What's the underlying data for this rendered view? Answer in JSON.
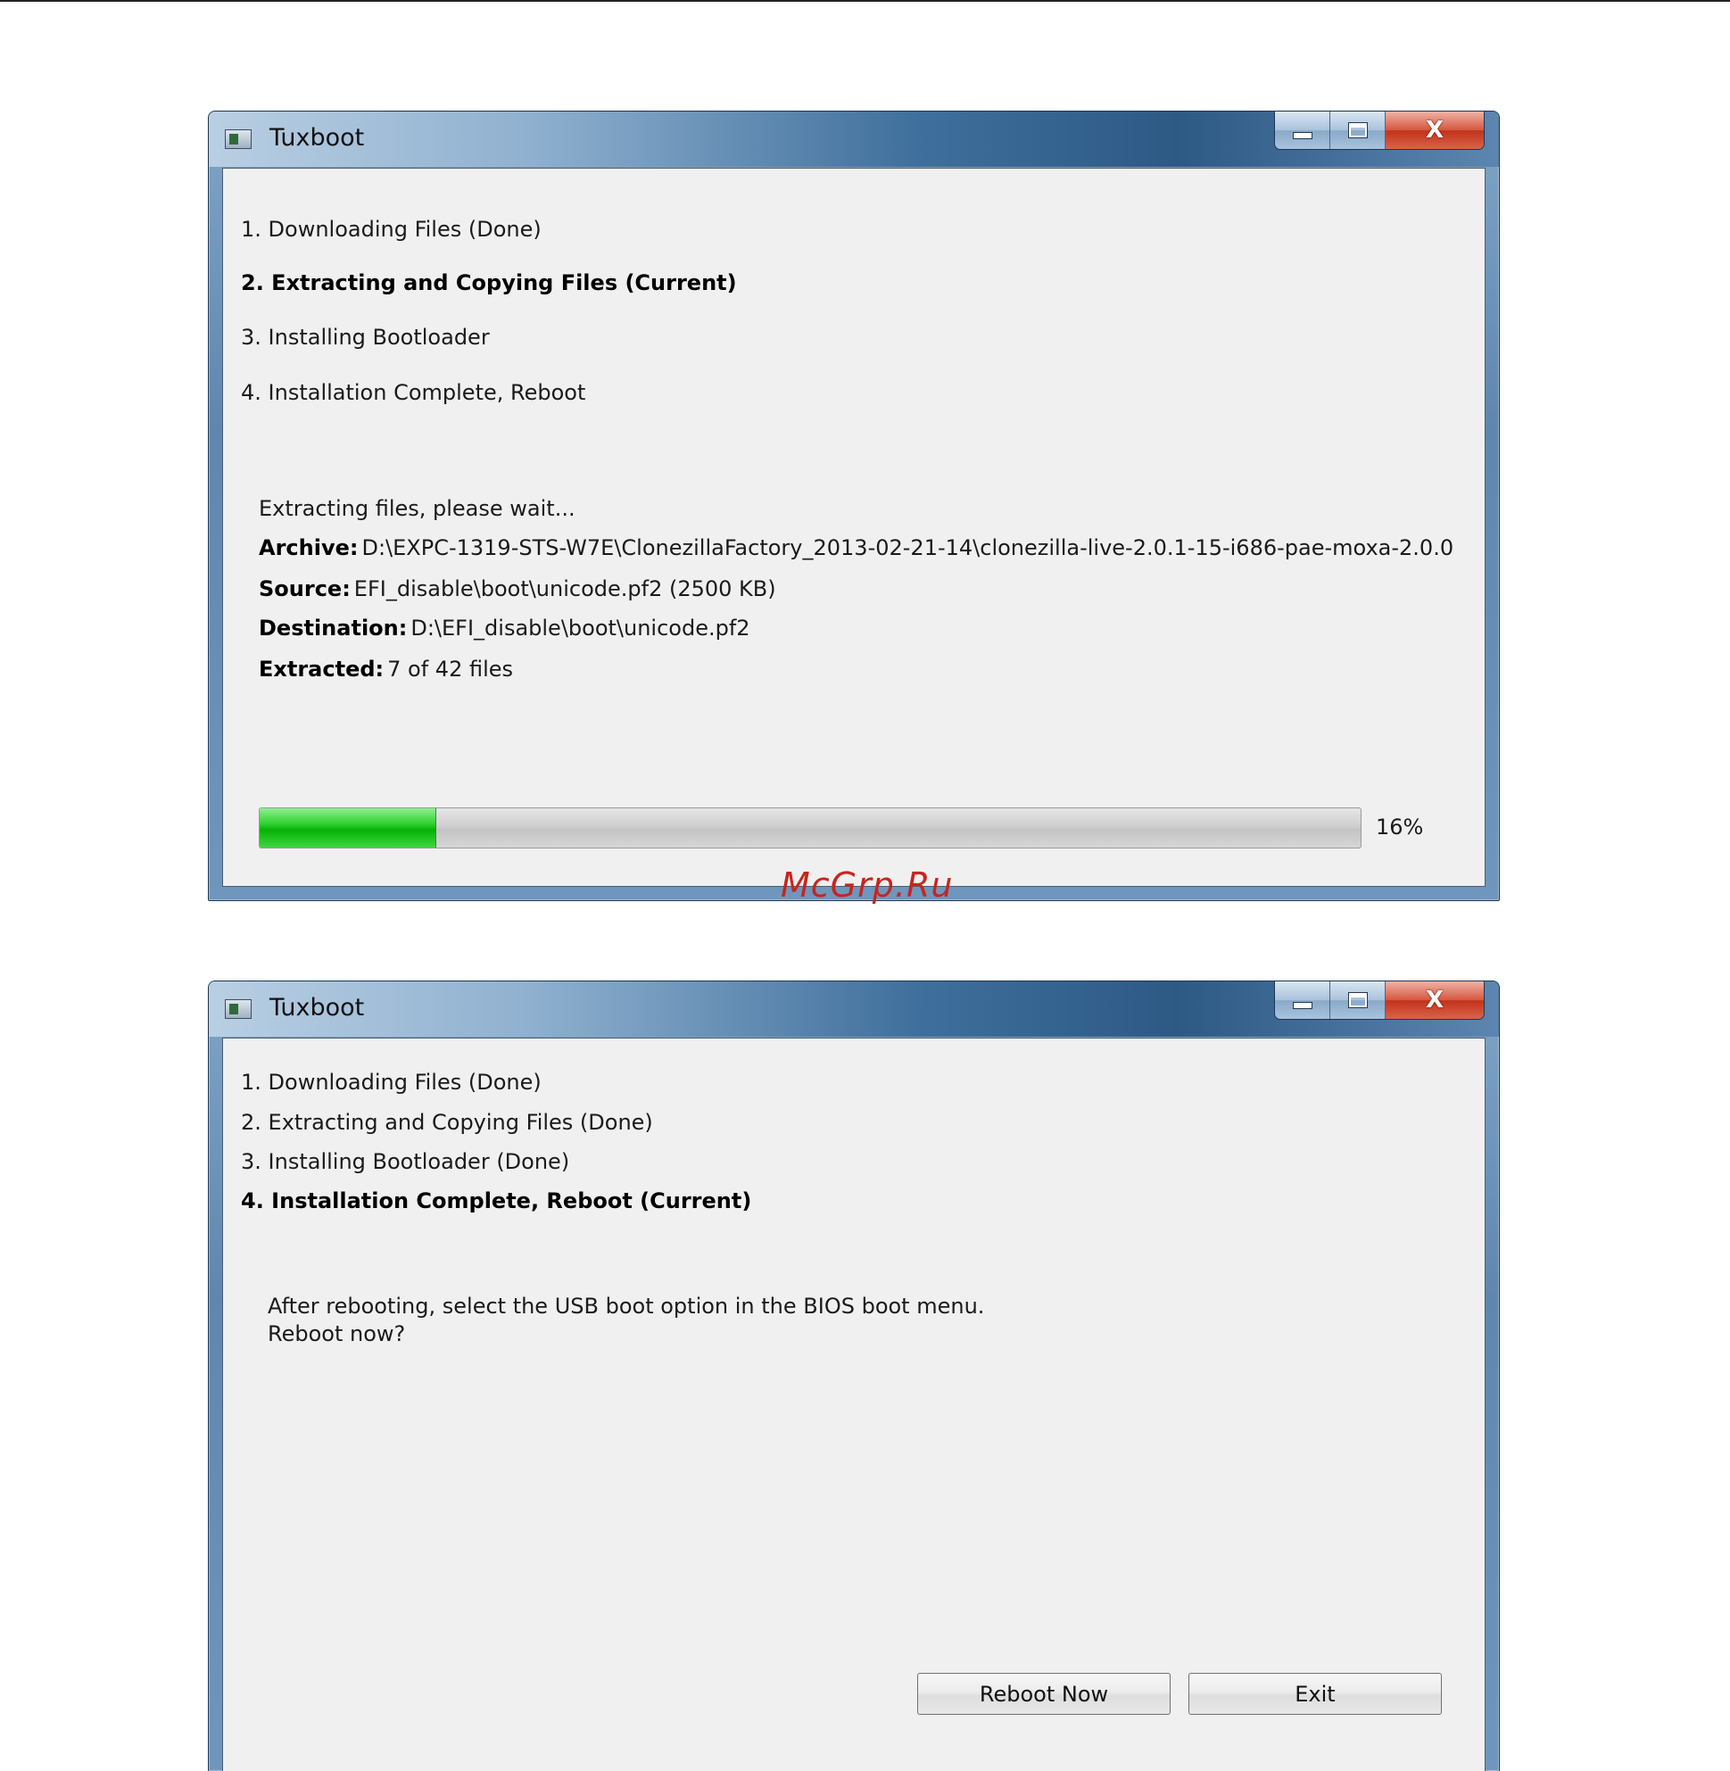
{
  "watermark": "McGrp.Ru",
  "window_top": {
    "title": "Tuxboot",
    "caption": {
      "minimize": "—",
      "maximize": "□",
      "close": "X"
    },
    "steps": [
      {
        "text": "1. Downloading Files (Done)",
        "current": false
      },
      {
        "text": "2. Extracting and Copying Files (Current)",
        "current": true
      },
      {
        "text": "3. Installing Bootloader",
        "current": false
      },
      {
        "text": "4. Installation Complete, Reboot",
        "current": false
      }
    ],
    "status": "Extracting files, please wait...",
    "archive": {
      "label": "Archive:",
      "value": "D:\\EXPC-1319-STS-W7E\\ClonezillaFactory_2013-02-21-14\\clonezilla-live-2.0.1-15-i686-pae-moxa-2.0.0"
    },
    "source": {
      "label": "Source:",
      "value": "EFI_disable\\boot\\unicode.pf2 (2500 KB)"
    },
    "destination": {
      "label": "Destination:",
      "value": "D:\\EFI_disable\\boot\\unicode.pf2"
    },
    "extracted": {
      "label": "Extracted:",
      "value": "7 of 42 files"
    },
    "progress": {
      "percent": 16,
      "text": "16%",
      "fill_color": "#14c414"
    }
  },
  "window_bottom": {
    "title": "Tuxboot",
    "caption": {
      "minimize": "—",
      "maximize": "□",
      "close": "X"
    },
    "steps": [
      {
        "text": "1. Downloading Files (Done)",
        "current": false
      },
      {
        "text": "2. Extracting and Copying Files (Done)",
        "current": false
      },
      {
        "text": "3. Installing Bootloader (Done)",
        "current": false
      },
      {
        "text": "4. Installation Complete, Reboot (Current)",
        "current": true
      }
    ],
    "message_line1": "After rebooting, select the USB boot option in the BIOS boot menu.",
    "message_line2": "Reboot now?",
    "reboot_button": "Reboot Now",
    "exit_button": "Exit"
  }
}
